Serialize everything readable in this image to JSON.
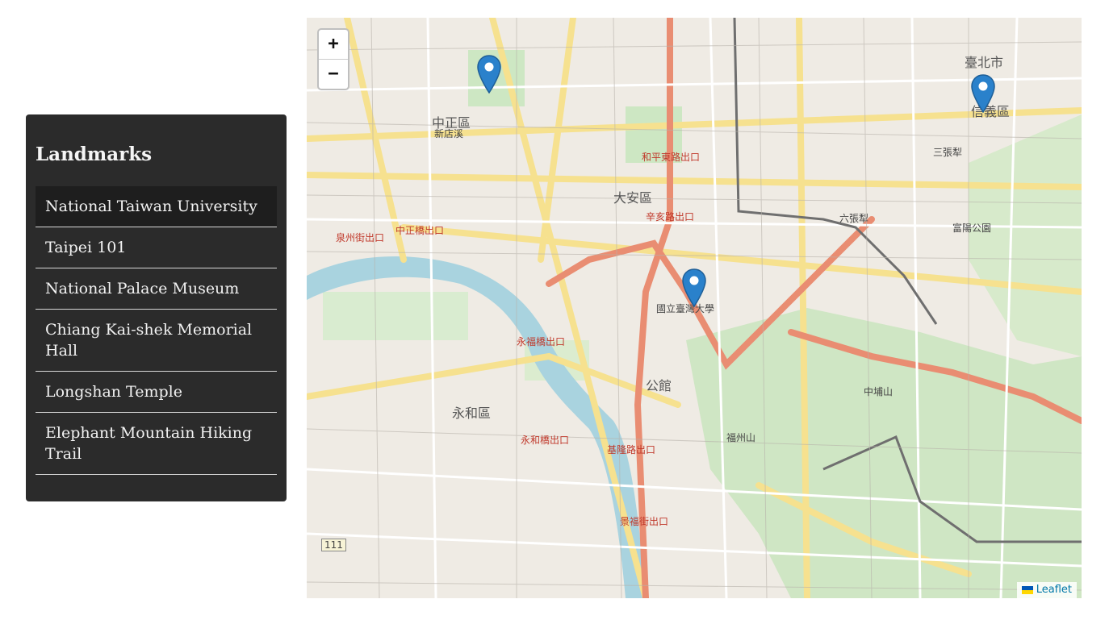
{
  "sidebar": {
    "title": "Landmarks",
    "items": [
      {
        "label": "National Taiwan University",
        "active": true
      },
      {
        "label": "Taipei 101",
        "active": false
      },
      {
        "label": "National Palace Museum",
        "active": false
      },
      {
        "label": "Chiang Kai-shek Memorial Hall",
        "active": false
      },
      {
        "label": "Longshan Temple",
        "active": false
      },
      {
        "label": "Elephant Mountain Hiking Trail",
        "active": false
      }
    ]
  },
  "map": {
    "zoom_in_label": "+",
    "zoom_out_label": "−",
    "attribution": "Leaflet",
    "marker_color": "#2a81cb",
    "labels": {
      "daan": "大安區",
      "zhongzheng": "中正區",
      "xinyi": "信義區",
      "taipei_city": "臺北市",
      "yonghe": "永和區",
      "ntu": "國立臺灣大學",
      "gongguan": "公館",
      "heping_e": "和平東路出口",
      "xinhai": "辛亥路出口",
      "quanzhou": "泉州街出口",
      "zhonghua": "中正橋出口",
      "yongfu": "永福橋出口",
      "jilong": "基隆路出口",
      "yonghe_bridge": "永和橋出口",
      "jingfu": "景福街出口",
      "xindian": "新店溪",
      "zhongpu": "中埔山",
      "fuzhou": "福州山",
      "liuzhang": "六張犁",
      "sanzhangli": "三張犁",
      "huafu": "富陽公園",
      "road_111": "111"
    }
  }
}
